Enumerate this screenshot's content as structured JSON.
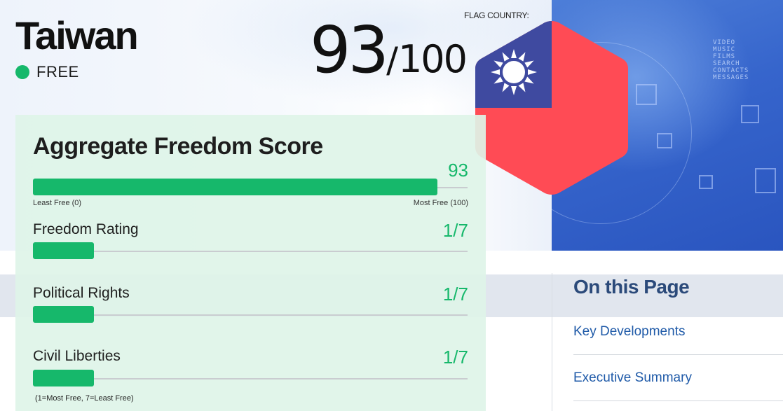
{
  "country": {
    "name": "Taiwan",
    "status": "FREE",
    "status_color": "#16b86b"
  },
  "score": {
    "value": "93",
    "separator": "/",
    "max": "100"
  },
  "flag": {
    "caption": "FLAG COUNTRY:",
    "colors": {
      "blue": "#3f4aa0",
      "red": "#ff4b55",
      "sun": "#ffffff"
    }
  },
  "aggregate": {
    "title": "Aggregate Freedom Score",
    "value_label": "93",
    "fraction": 0.93,
    "scale_min_label": "Least Free (0)",
    "scale_max_label": "Most Free (100)"
  },
  "ratings": [
    {
      "label": "Freedom Rating",
      "value": "1/7",
      "fraction": 0.14
    },
    {
      "label": "Political Rights",
      "value": "1/7",
      "fraction": 0.14
    },
    {
      "label": "Civil Liberties",
      "value": "1/7",
      "fraction": 0.14
    }
  ],
  "ratings_note": "(1=Most Free, 7=Least Free)",
  "on_this_page": {
    "title": "On this Page",
    "links": [
      "Key Developments",
      "Executive Summary"
    ]
  },
  "hero_tech_text": [
    "VIDEO",
    "MUSIC",
    "FILMS",
    "SEARCH",
    "CONTACTS",
    "MESSAGES"
  ],
  "accent_color": "#16b86b"
}
